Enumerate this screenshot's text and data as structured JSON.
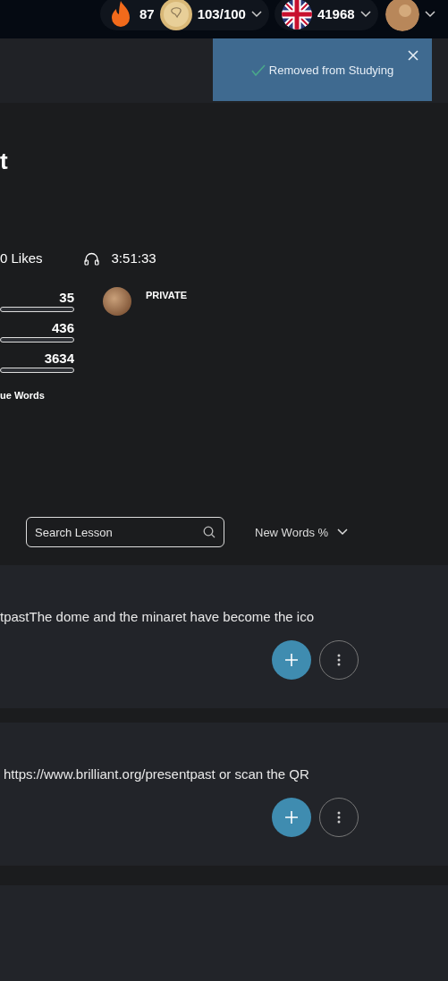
{
  "top_bar": {
    "streak": "87",
    "coins": "103/100",
    "points": "41968"
  },
  "toast": {
    "message": "Removed from Studying"
  },
  "course": {
    "title": "t",
    "likes": "0 Likes",
    "duration": "3:51:33",
    "stats": [
      {
        "value": "35"
      },
      {
        "value": "436"
      },
      {
        "value": "3634"
      }
    ],
    "stats_label": "ue Words",
    "privacy": "PRIVATE"
  },
  "search": {
    "placeholder": "Search Lesson"
  },
  "sort": {
    "label": "New Words %"
  },
  "lessons": [
    {
      "excerpt": "tpastThe dome and the minaret have become the ico"
    },
    {
      "excerpt": "https://www.brilliant.org/presentpast or scan the QR"
    }
  ]
}
